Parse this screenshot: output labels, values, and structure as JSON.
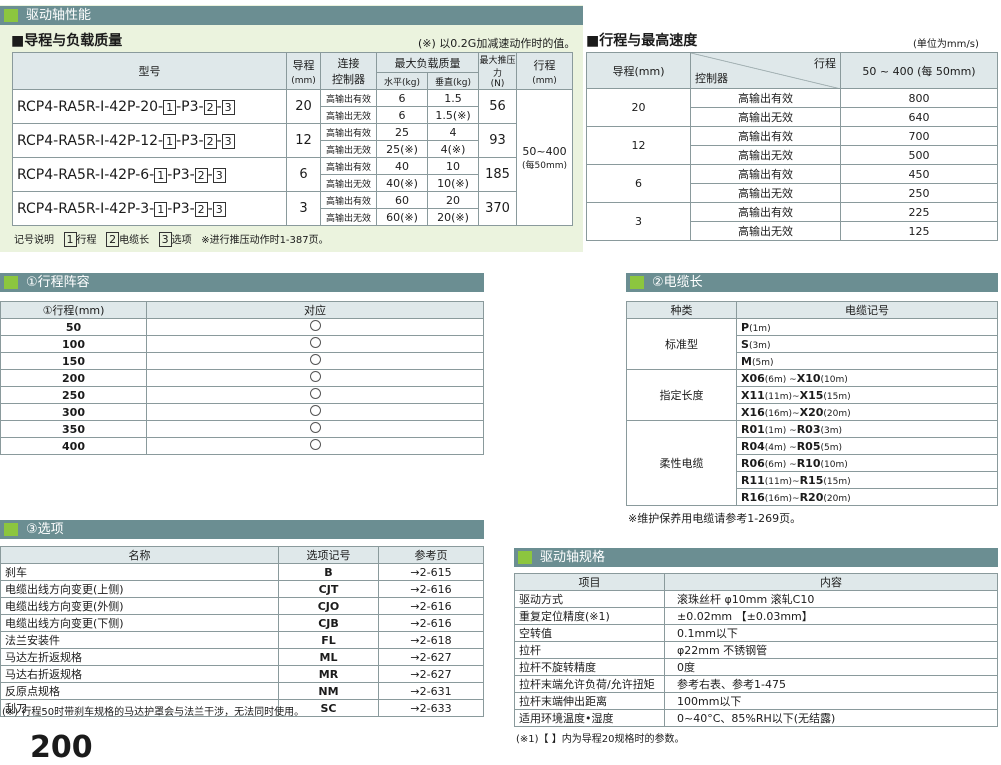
{
  "sec1": {
    "title": "驱动轴性能"
  },
  "lead": {
    "title": "■导程与负载质量",
    "note": "(※) 以0.2G加减速动作时的值。",
    "h_model": "型号",
    "h_lead": "导程",
    "h_lead_u": "(mm)",
    "h_ctrl1": "连接",
    "h_ctrl2": "控制器",
    "h_max": "最大负载质量",
    "h_horiz": "水平",
    "h_vert": "垂直",
    "h_kg": "(kg)",
    "h_push": "最大推压力",
    "h_push_u": "(N)",
    "h_stroke": "行程",
    "h_stroke_u": "(mm)",
    "stroke_val": "50~400",
    "stroke_sub": "(每50mm)",
    "rows": [
      {
        "model": "RCP4-RA5R-I-42P-20-",
        "sfx": "-P3-",
        "lead": "20",
        "c1": "高输出有效",
        "c2": "高输出无效",
        "h1": "6",
        "h2": "6",
        "v1": "1.5",
        "v2": "1.5(※)",
        "push": "56"
      },
      {
        "model": "RCP4-RA5R-I-42P-12-",
        "sfx": "-P3-",
        "lead": "12",
        "c1": "高输出有效",
        "c2": "高输出无效",
        "h1": "25",
        "h2": "25(※)",
        "v1": "4",
        "v2": "4(※)",
        "push": "93"
      },
      {
        "model": "RCP4-RA5R-I-42P-6-",
        "sfx": "-P3-",
        "lead": "6",
        "c1": "高输出有效",
        "c2": "高输出无效",
        "h1": "40",
        "h2": "40(※)",
        "v1": "10",
        "v2": "10(※)",
        "push": "185"
      },
      {
        "model": "RCP4-RA5R-I-42P-3-",
        "sfx": "-P3-",
        "lead": "3",
        "c1": "高输出有效",
        "c2": "高输出无效",
        "h1": "60",
        "h2": "60(※)",
        "v1": "20",
        "v2": "20(※)",
        "push": "370"
      }
    ],
    "legend": "记号说明",
    "lg1": "行程",
    "lg2": "电缆长",
    "lg3": "选项",
    "lg_note": "※进行推压动作时1-387页。",
    "n1": "1",
    "n2": "2",
    "n3": "3"
  },
  "speed": {
    "title": "■行程与最高速度",
    "unit": "(单位为mm/s)",
    "h_lead": "导程(mm)",
    "h_ctrl": "控制器",
    "h_stroke": "行程",
    "h_range": "50 ~ 400 (每 50mm)",
    "rows": [
      {
        "lead": "20",
        "a": "高输出有效",
        "av": "800",
        "b": "高输出无效",
        "bv": "640"
      },
      {
        "lead": "12",
        "a": "高输出有效",
        "av": "700",
        "b": "高输出无效",
        "bv": "500"
      },
      {
        "lead": "6",
        "a": "高输出有效",
        "av": "450",
        "b": "高输出无效",
        "bv": "250"
      },
      {
        "lead": "3",
        "a": "高输出有效",
        "av": "225",
        "b": "高输出无效",
        "bv": "125"
      }
    ]
  },
  "strokes": {
    "title": "①行程阵容",
    "h1": "①行程(mm)",
    "h2": "对应",
    "rows": [
      "50",
      "100",
      "150",
      "200",
      "250",
      "300",
      "350",
      "400"
    ]
  },
  "cable": {
    "title": "②电缆长",
    "h1": "种类",
    "h2": "电缆记号",
    "std": "标准型",
    "std_rows": [
      [
        "P",
        "(1m)"
      ],
      [
        "S",
        "(3m)"
      ],
      [
        "M",
        "(5m)"
      ]
    ],
    "spec": "指定长度",
    "spec_rows": [
      [
        "X06",
        "(6m) ~",
        "X10",
        "(10m)"
      ],
      [
        "X11",
        "(11m)~",
        "X15",
        "(15m)"
      ],
      [
        "X16",
        "(16m)~",
        "X20",
        "(20m)"
      ]
    ],
    "flex": "柔性电缆",
    "flex_rows": [
      [
        "R01",
        "(1m) ~",
        "R03",
        "(3m)"
      ],
      [
        "R04",
        "(4m) ~",
        "R05",
        "(5m)"
      ],
      [
        "R06",
        "(6m) ~",
        "R10",
        "(10m)"
      ],
      [
        "R11",
        "(11m)~",
        "R15",
        "(15m)"
      ],
      [
        "R16",
        "(16m)~",
        "R20",
        "(20m)"
      ]
    ],
    "note": "※维护保养用电缆请参考1-269页。"
  },
  "options": {
    "title": "③选项",
    "h1": "名称",
    "h2": "选项记号",
    "h3": "参考页",
    "rows": [
      [
        "刹车",
        "B",
        "→2-615"
      ],
      [
        "电缆出线方向变更(上侧)",
        "CJT",
        "→2-616"
      ],
      [
        "电缆出线方向变更(外侧)",
        "CJO",
        "→2-616"
      ],
      [
        "电缆出线方向变更(下侧)",
        "CJB",
        "→2-616"
      ],
      [
        "法兰安装件",
        "FL",
        "→2-618"
      ],
      [
        "马达左折返规格",
        "ML",
        "→2-627"
      ],
      [
        "马达右折返规格",
        "MR",
        "→2-627"
      ],
      [
        "反原点规格",
        "NM",
        "→2-631"
      ],
      [
        "刮刀",
        "SC",
        "→2-633"
      ]
    ],
    "note": "(※) 行程50时带刹车规格的马达护罩会与法兰干涉，无法同时使用。"
  },
  "spec": {
    "title": "驱动轴规格",
    "h1": "项目",
    "h2": "内容",
    "rows": [
      [
        "驱动方式",
        "滚珠丝杆  φ10mm  滚轧C10"
      ],
      [
        "重复定位精度(※1)",
        "±0.02mm 【±0.03mm】"
      ],
      [
        "空转值",
        "0.1mm以下"
      ],
      [
        "拉杆",
        "φ22mm  不锈钢管"
      ],
      [
        "拉杆不旋转精度",
        "0度"
      ],
      [
        "拉杆末端允许负荷/允许扭矩",
        "参考右表、参考1-475"
      ],
      [
        "拉杆末端伸出距离",
        "100mm以下"
      ],
      [
        "适用环境温度•湿度",
        "0~40°C、85%RH以下(无结露)"
      ]
    ],
    "note": "(※1)【 】内为导程20规格时的参数。"
  },
  "page_no": "200"
}
